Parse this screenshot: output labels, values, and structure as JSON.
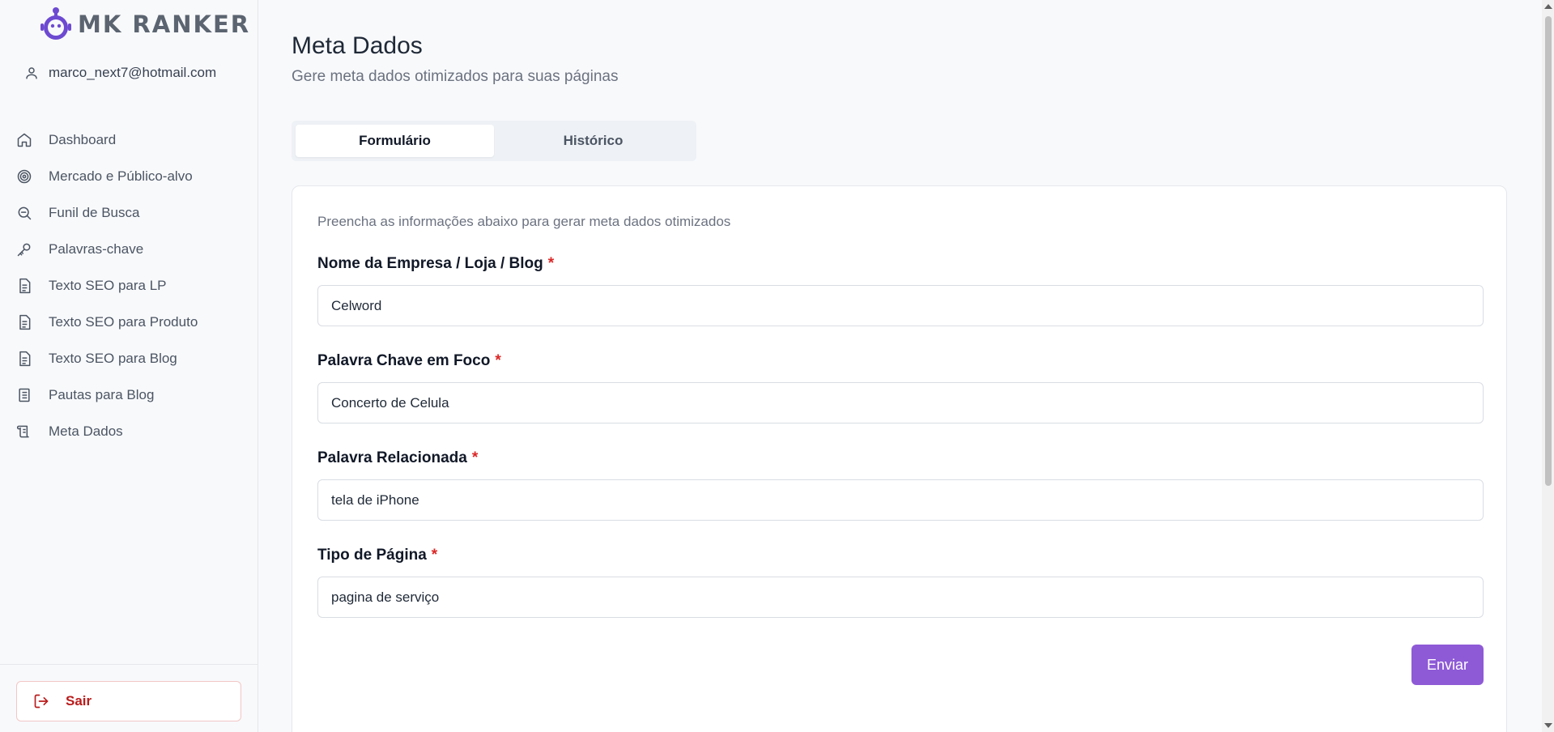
{
  "brand": {
    "name": "MK RANKER",
    "accent": "#6d4ad1"
  },
  "user": {
    "email": "marco_next7@hotmail.com"
  },
  "sidebar": {
    "items": [
      {
        "label": "Dashboard",
        "icon": "home-icon"
      },
      {
        "label": "Mercado e Público-alvo",
        "icon": "target-icon"
      },
      {
        "label": "Funil de Busca",
        "icon": "search-icon"
      },
      {
        "label": "Palavras-chave",
        "icon": "key-icon"
      },
      {
        "label": "Texto SEO para LP",
        "icon": "document-icon"
      },
      {
        "label": "Texto SEO para Produto",
        "icon": "document-icon"
      },
      {
        "label": "Texto SEO para Blog",
        "icon": "document-icon"
      },
      {
        "label": "Pautas para Blog",
        "icon": "notebook-icon"
      },
      {
        "label": "Meta Dados",
        "icon": "scroll-icon"
      }
    ],
    "logout_label": "Sair"
  },
  "page": {
    "title": "Meta Dados",
    "subtitle": "Gere meta dados otimizados para suas páginas"
  },
  "tabs": [
    {
      "label": "Formulário",
      "active": true
    },
    {
      "label": "Histórico",
      "active": false
    }
  ],
  "form": {
    "description": "Preencha as informações abaixo para gerar meta dados otimizados",
    "required_marker": "*",
    "fields": [
      {
        "label": "Nome da Empresa / Loja / Blog",
        "value": "Celword"
      },
      {
        "label": "Palavra Chave em Foco",
        "value": "Concerto de Celula"
      },
      {
        "label": "Palavra Relacionada",
        "value": "tela de iPhone"
      },
      {
        "label": "Tipo de Página",
        "value": "pagina de serviço"
      }
    ],
    "submit_label": "Enviar",
    "submit_color": "#8e5ad6"
  }
}
